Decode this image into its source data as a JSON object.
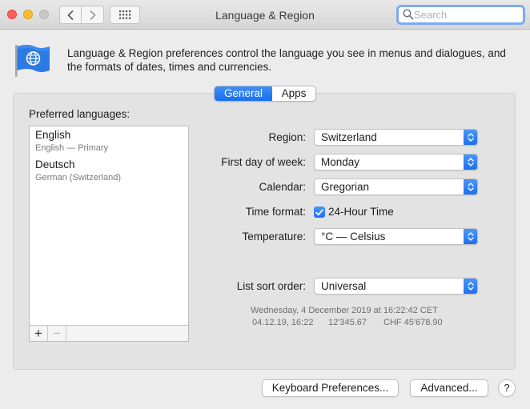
{
  "window": {
    "title": "Language & Region"
  },
  "search": {
    "placeholder": "Search"
  },
  "header": {
    "description": "Language & Region preferences control the language you see in menus and dialogues, and the formats of dates, times and currencies."
  },
  "tabs": [
    {
      "label": "General",
      "selected": true
    },
    {
      "label": "Apps",
      "selected": false
    }
  ],
  "preferred_languages": {
    "label": "Preferred languages:",
    "items": [
      {
        "name": "English",
        "detail": "English — Primary"
      },
      {
        "name": "Deutsch",
        "detail": "German (Switzerland)"
      }
    ],
    "add_symbol": "+",
    "remove_symbol": "−"
  },
  "settings": {
    "region": {
      "label": "Region:",
      "value": "Switzerland"
    },
    "first_day": {
      "label": "First day of week:",
      "value": "Monday"
    },
    "calendar": {
      "label": "Calendar:",
      "value": "Gregorian"
    },
    "time_format": {
      "label": "Time format:",
      "checkbox_label": "24-Hour Time",
      "checked": true
    },
    "temperature": {
      "label": "Temperature:",
      "value": "°C — Celsius"
    },
    "sort_order": {
      "label": "List sort order:",
      "value": "Universal"
    }
  },
  "sample": {
    "date_long": "Wednesday, 4 December 2019 at 16:22:42 CET",
    "date_short": "04.12.19, 16:22",
    "number": "12'345.67",
    "currency": "CHF 45'678.90"
  },
  "buttons": {
    "keyboard": "Keyboard Preferences...",
    "advanced": "Advanced...",
    "help": "?"
  },
  "colors": {
    "accent": "#1b6ff0",
    "close": "#fc5f57",
    "minimize": "#fdbc2e",
    "search_focus": "#7eaaf1"
  },
  "icons": {
    "flag": "flag-globe-icon",
    "back": "chevron-left-icon",
    "forward": "chevron-right-icon",
    "grid": "grid-icon",
    "search": "search-icon",
    "popup": "up-down-chevron-icon",
    "check": "checkmark-icon"
  }
}
